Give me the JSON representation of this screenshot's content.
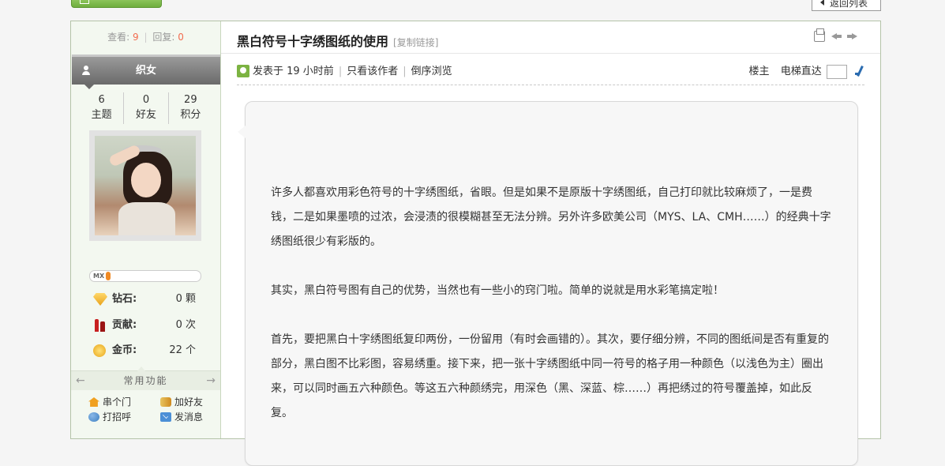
{
  "header": {
    "back_label": "返回列表"
  },
  "sidebar": {
    "views_label": "查看:",
    "views_value": "9",
    "replies_label": "回复:",
    "replies_value": "0",
    "username": "织女",
    "counts": [
      {
        "value": "6",
        "label": "主题"
      },
      {
        "value": "0",
        "label": "好友"
      },
      {
        "value": "29",
        "label": "积分"
      }
    ],
    "level_badge": "MX",
    "level_progress": 0.05,
    "properties": [
      {
        "icon": "diamond-icon",
        "label": "钻石:",
        "value": "0 颗"
      },
      {
        "icon": "contribution-icon",
        "label": "贡献:",
        "value": "0 次"
      },
      {
        "icon": "coin-icon",
        "label": "金币:",
        "value": "22 个"
      }
    ],
    "common_functions_label": "常用功能",
    "actions": [
      {
        "icon": "home-icon",
        "label": "串个门"
      },
      {
        "icon": "add-friend-icon",
        "label": "加好友"
      },
      {
        "icon": "greet-icon",
        "label": "打招呼"
      },
      {
        "icon": "message-icon",
        "label": "发消息"
      }
    ]
  },
  "post": {
    "title": "黑白符号十字绣图纸的使用",
    "copy_link": "[复制链接]",
    "meta": {
      "posted": "发表于 19 小时前",
      "author_only": "只看该作者",
      "reverse": "倒序浏览",
      "floor": "楼主",
      "elevator": "电梯直达"
    },
    "paragraphs": [
      "许多人都喜欢用彩色符号的十字绣图纸，省眼。但是如果不是原版十字绣图纸，自己打印就比较麻烦了，一是费钱，二是如果墨喷的过浓，会浸渍的很模糊甚至无法分辨。另外许多欧美公司（MYS、LA、CMH……）的经典十字绣图纸很少有彩版的。",
      "其实，黑白符号图有自己的优势，当然也有一些小的窍门啦。简单的说就是用水彩笔搞定啦！",
      "首先，要把黑白十字绣图纸复印两份，一份留用（有时会画错的）。其次，要仔细分辨，不同的图纸间是否有重复的部分，黑白图不比彩图，容易绣重。接下来，把一张十字绣图纸中同一符号的格子用一种颜色（以浅色为主）圈出来，可以同时画五六种颜色。等这五六种颜绣完，用深色（黑、深蓝、棕……）再把绣过的符号覆盖掉，如此反复。"
    ]
  }
}
